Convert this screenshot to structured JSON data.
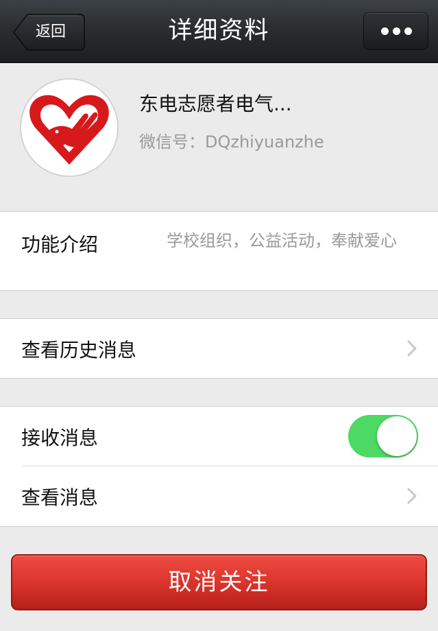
{
  "navbar": {
    "back_label": "返回",
    "title": "详细资料",
    "more_icon": "more-dots-icon"
  },
  "profile": {
    "name": "东电志愿者电气...",
    "wechat_id": "微信号：DQzhiyuanzhe",
    "avatar_icon": "heart-dove-logo"
  },
  "intro": {
    "label": "功能介绍",
    "value": "学校组织，公益活动，奉献爱心"
  },
  "history": {
    "label": "查看历史消息"
  },
  "receive": {
    "label": "接收消息",
    "toggle_on": true
  },
  "view": {
    "label": "查看消息"
  },
  "unfollow": {
    "label": "取消关注"
  },
  "colors": {
    "toggle_on": "#4cd964",
    "unfollow_red": "#d9322b"
  }
}
